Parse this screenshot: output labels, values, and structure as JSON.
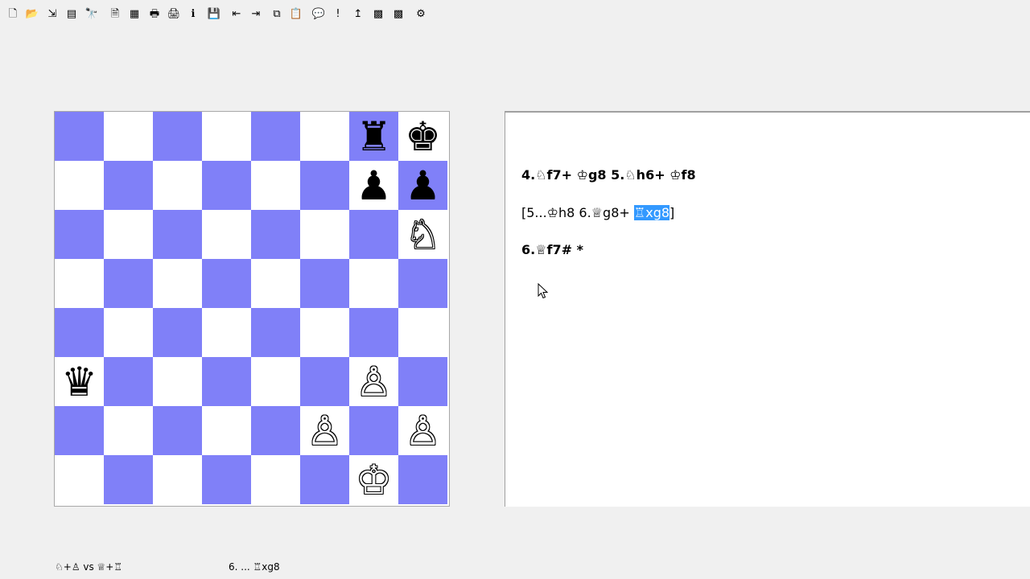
{
  "toolbar": {
    "icons": [
      {
        "name": "new-document-icon",
        "glyph": "🗋"
      },
      {
        "name": "open-folder-icon",
        "glyph": "📂"
      },
      {
        "name": "import-icon",
        "glyph": "⇲"
      },
      {
        "name": "notes-icon",
        "glyph": "▤"
      },
      {
        "name": "binoculars-icon",
        "glyph": "🔭"
      },
      {
        "name": "page-icon",
        "glyph": "🗎"
      },
      {
        "name": "board-pattern-icon",
        "glyph": "▦"
      },
      {
        "name": "print-icon",
        "glyph": "🖶"
      },
      {
        "name": "print-preview-icon",
        "glyph": "🖨"
      },
      {
        "name": "info-icon",
        "glyph": "ℹ"
      },
      {
        "name": "save-icon",
        "glyph": "💾"
      },
      {
        "name": "move-back-icon",
        "glyph": "⇤"
      },
      {
        "name": "move-forward-icon",
        "glyph": "⇥"
      },
      {
        "name": "copy-icon",
        "glyph": "⧉"
      },
      {
        "name": "paste-icon",
        "glyph": "📋"
      },
      {
        "name": "comment-icon",
        "glyph": "💬"
      },
      {
        "name": "exclamation-icon",
        "glyph": "!"
      },
      {
        "name": "promote-icon",
        "glyph": "↥"
      },
      {
        "name": "board-setup-icon",
        "glyph": "▩"
      },
      {
        "name": "board-disabled-icon",
        "glyph": "▩"
      },
      {
        "name": "engine-icon",
        "glyph": "⚙"
      }
    ]
  },
  "board": {
    "pieces": [
      {
        "square": "g8",
        "symbol": "♜",
        "color": "black",
        "name": "black-rook"
      },
      {
        "square": "h8",
        "symbol": "♚",
        "color": "black",
        "name": "black-king"
      },
      {
        "square": "g7",
        "symbol": "♟",
        "color": "black",
        "name": "black-pawn"
      },
      {
        "square": "h7",
        "symbol": "♟",
        "color": "black",
        "name": "black-pawn"
      },
      {
        "square": "h6",
        "symbol": "♘",
        "color": "white",
        "name": "white-knight"
      },
      {
        "square": "a3",
        "symbol": "♛",
        "color": "black",
        "name": "black-queen"
      },
      {
        "square": "g3",
        "symbol": "♙",
        "color": "white",
        "name": "white-pawn"
      },
      {
        "square": "f2",
        "symbol": "♙",
        "color": "white",
        "name": "white-pawn"
      },
      {
        "square": "h2",
        "symbol": "♙",
        "color": "white",
        "name": "white-pawn"
      },
      {
        "square": "g1",
        "symbol": "♔",
        "color": "white",
        "name": "white-king"
      }
    ]
  },
  "notation": {
    "line1": "4.♘f7+ ♔g8 5.♘h6+ ♔f8",
    "line2_prefix": "[5...♔h8 6.♕g8+ ",
    "line2_selected": "♖xg8",
    "line2_suffix": "]",
    "line3": "6.♕f7# *"
  },
  "status": {
    "material": "♘+♙ vs ♕+♖",
    "current_move": "6. ... ♖xg8"
  }
}
